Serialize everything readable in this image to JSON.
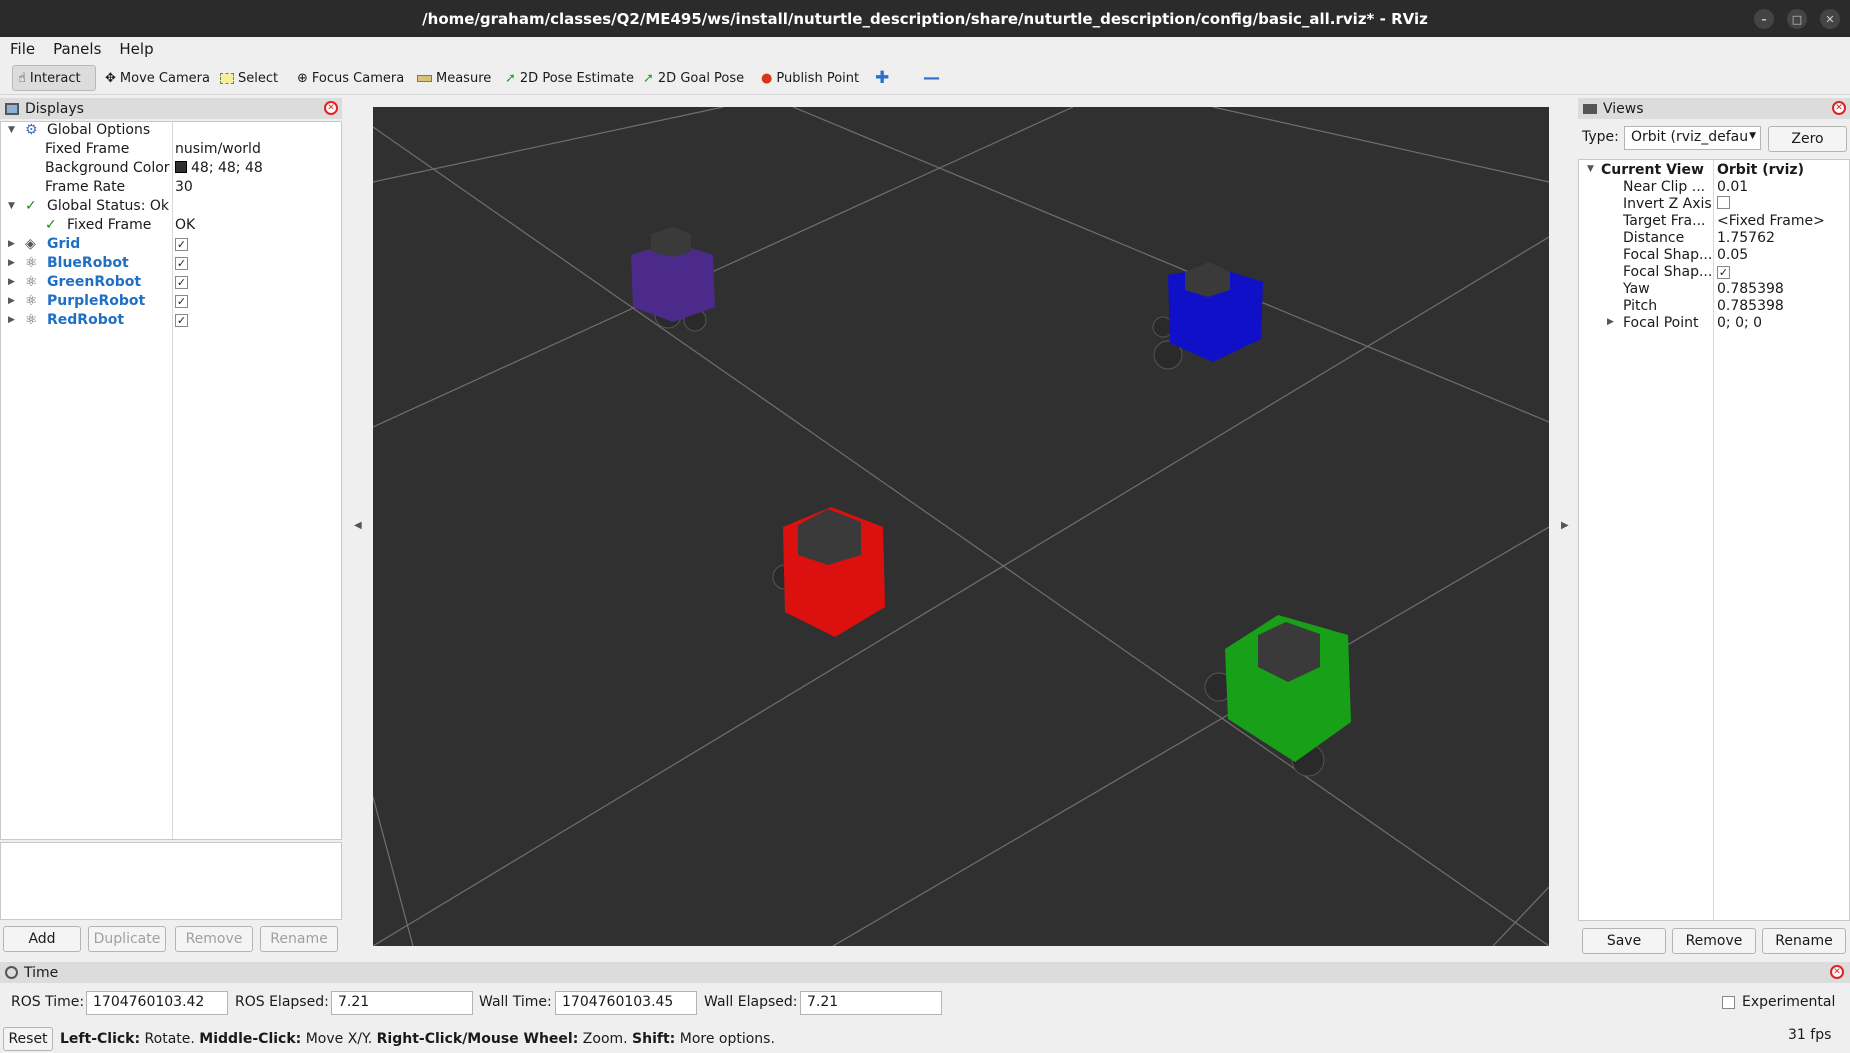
{
  "window": {
    "title": "/home/graham/classes/Q2/ME495/ws/install/nuturtle_description/share/nuturtle_description/config/basic_all.rviz* - RViz"
  },
  "menu": {
    "file": "File",
    "panels": "Panels",
    "help": "Help"
  },
  "toolbar": {
    "interact": "Interact",
    "move_camera": "Move Camera",
    "select": "Select",
    "focus_camera": "Focus Camera",
    "measure": "Measure",
    "pose_estimate": "2D Pose Estimate",
    "goal_pose": "2D Goal Pose",
    "publish_point": "Publish Point"
  },
  "displays": {
    "title": "Displays",
    "global_options": "Global Options",
    "fixed_frame_label": "Fixed Frame",
    "fixed_frame_value": "nusim/world",
    "bg_color_label": "Background Color",
    "bg_color_value": "48; 48; 48",
    "bg_color_hex": "#303030",
    "frame_rate_label": "Frame Rate",
    "frame_rate_value": "30",
    "global_status": "Global Status: Ok",
    "status_fixed_frame": "Fixed Frame",
    "status_fixed_frame_value": "OK",
    "items": [
      {
        "label": "Grid",
        "checked": true
      },
      {
        "label": "BlueRobot",
        "checked": true
      },
      {
        "label": "GreenRobot",
        "checked": true
      },
      {
        "label": "PurpleRobot",
        "checked": true
      },
      {
        "label": "RedRobot",
        "checked": true
      }
    ],
    "buttons": {
      "add": "Add",
      "duplicate": "Duplicate",
      "remove": "Remove",
      "rename": "Rename"
    }
  },
  "viewport": {
    "robots": [
      {
        "name": "PurpleRobot",
        "color": "#4b2a8c"
      },
      {
        "name": "BlueRobot",
        "color": "#1010c8"
      },
      {
        "name": "RedRobot",
        "color": "#dd1010"
      },
      {
        "name": "GreenRobot",
        "color": "#18a018"
      }
    ]
  },
  "views": {
    "title": "Views",
    "type_label": "Type:",
    "type_value": "Orbit (rviz_defau",
    "zero": "Zero",
    "current_view_label": "Current View",
    "current_view_value": "Orbit (rviz)",
    "props": [
      {
        "k": "Near Clip ...",
        "v": "0.01"
      },
      {
        "k": "Invert Z Axis",
        "v": ""
      },
      {
        "k": "Target Fra...",
        "v": "<Fixed Frame>"
      },
      {
        "k": "Distance",
        "v": "1.75762"
      },
      {
        "k": "Focal Shap...",
        "v": "0.05"
      },
      {
        "k": "Focal Shap...",
        "v": ""
      },
      {
        "k": "Yaw",
        "v": "0.785398"
      },
      {
        "k": "Pitch",
        "v": "0.785398"
      },
      {
        "k": "Focal Point",
        "v": "0; 0; 0"
      }
    ],
    "buttons": {
      "save": "Save",
      "remove": "Remove",
      "rename": "Rename"
    }
  },
  "time": {
    "title": "Time",
    "ros_time_label": "ROS Time:",
    "ros_time": "1704760103.42",
    "ros_elapsed_label": "ROS Elapsed:",
    "ros_elapsed": "7.21",
    "wall_time_label": "Wall Time:",
    "wall_time": "1704760103.45",
    "wall_elapsed_label": "Wall Elapsed:",
    "wall_elapsed": "7.21",
    "experimental": "Experimental"
  },
  "status": {
    "reset": "Reset",
    "left_click": "Left-Click:",
    "left_click_desc": "Rotate.",
    "middle_click": "Middle-Click:",
    "middle_click_desc": "Move X/Y.",
    "right_click": "Right-Click/Mouse Wheel:",
    "right_click_desc": "Zoom.",
    "shift": "Shift:",
    "shift_desc": "More options.",
    "fps": "31 fps"
  }
}
